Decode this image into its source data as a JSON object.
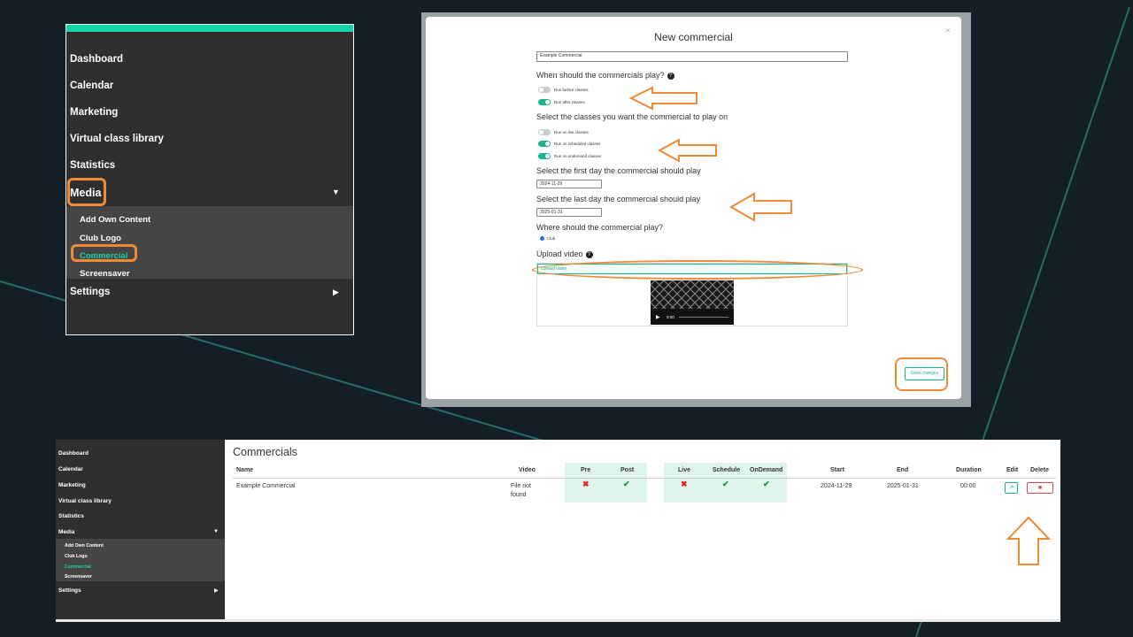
{
  "sidebar_large": {
    "items": [
      "Dashboard",
      "Calendar",
      "Marketing",
      "Virtual class library",
      "Statistics",
      "Media",
      "Settings"
    ],
    "media_sub": [
      "Add Own Content",
      "Club Logo",
      "Commercial",
      "Screensaver"
    ]
  },
  "modal": {
    "title": "New commercial",
    "close": "×",
    "name_value": "Example Commercial",
    "q_play": "When should the commercials play?",
    "run_before": "Run before classes",
    "run_after": "Run after classes",
    "q_classes": "Select the classes you want the commercial to play on",
    "run_live": "Run on live classes",
    "run_scheduled": "Run on scheduled classes",
    "run_ondemand": "Run on ondemand classes",
    "q_first_day": "Select the first day the commercial should play",
    "first_day": "2024-11-29",
    "q_last_day": "Select the last day the commercial should play",
    "last_day": "2025-01-31",
    "q_where": "Where should the commercial play?",
    "where_option": "Club",
    "upload_label": "Upload video",
    "upload_button": "Upload video",
    "video_time": "0:00",
    "save_button": "Save changes"
  },
  "sidebar_small": {
    "items": [
      "Dashboard",
      "Calendar",
      "Marketing",
      "Virtual class library",
      "Statistics",
      "Media",
      "Settings"
    ],
    "media_sub": [
      "Add Own Content",
      "Club Logo",
      "Commercial",
      "Screensaver"
    ]
  },
  "commercials": {
    "title": "Commercials",
    "headers": [
      "Name",
      "Video",
      "Pre",
      "Post",
      "Live",
      "Schedule",
      "OnDemand",
      "Start",
      "End",
      "Duration",
      "Edit",
      "Delete"
    ],
    "row": {
      "name": "Example Commercial",
      "video_line1": "File not",
      "video_line2": "found",
      "pre": "✖",
      "post": "✔",
      "live": "✖",
      "schedule": "✔",
      "ondemand": "✔",
      "start": "2024-11-29",
      "end": "2025-01-31",
      "duration": "00:00"
    }
  },
  "colors": {
    "accent": "#19d3a8",
    "highlight": "#f08a37",
    "background": "#131e26"
  }
}
